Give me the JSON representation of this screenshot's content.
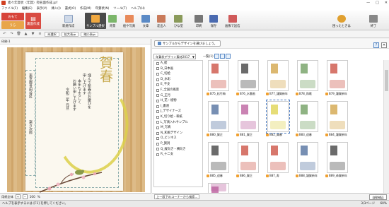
{
  "window": {
    "title": "素々年賀状（年賀）宛名面作成.jpf",
    "controls": [
      "—",
      "□",
      "✕"
    ]
  },
  "menu": [
    "ファイル(F)",
    "編集(E)",
    "表示(V)",
    "挿入(I)",
    "書式(O)",
    "作成(M)",
    "年賀状(N)",
    "ツール(T)",
    "ヘルプ(H)"
  ],
  "ribbon": {
    "side_tabs": {
      "front": "おもて",
      "back": "うら"
    },
    "vertical_tab": "新規作成",
    "buttons": [
      {
        "label": "新規作成"
      },
      {
        "label": "サンプル選択",
        "active": true
      },
      {
        "label": "背景"
      },
      {
        "label": "絵や写真"
      },
      {
        "label": "文章"
      },
      {
        "label": "差出人"
      },
      {
        "label": "ひな型"
      },
      {
        "label": "印刷"
      },
      {
        "label": "保存"
      },
      {
        "label": "画像で送信"
      }
    ],
    "right_buttons": [
      {
        "label": "困ったときは"
      },
      {
        "label": "終了"
      }
    ],
    "side_label": "裏面作成"
  },
  "toolbar2": {
    "chips": [
      "未選択",
      "拡大表示",
      "縮小表示"
    ]
  },
  "left_panel": {
    "header": "印刷-1",
    "postcard": {
      "kanji": "賀春",
      "message": [
        "謹んで新春のお慶びを",
        "申し上げます",
        "本年もよろしく",
        "お願い申し上げます",
        "令和二年 元旦"
      ],
      "name_lines": [
        "東京都世田谷区",
        "楽々次郎"
      ]
    },
    "zoom": {
      "label": "用紙全体",
      "value": "100",
      "unit": "%"
    }
  },
  "right_panel": {
    "button": "サンプルからデザインを選びましょう。",
    "category_select": "年賀状デザイン素材2017",
    "count": "一覧(1)",
    "categories": [
      {
        "label": "A_絵",
        "checked": false
      },
      {
        "label": "B_日本画",
        "checked": false
      },
      {
        "label": "C_切絵",
        "checked": false
      },
      {
        "label": "D_水彩",
        "checked": false
      },
      {
        "label": "E_干支",
        "checked": false
      },
      {
        "label": "F_全国の風景",
        "checked": false
      },
      {
        "label": "G_正月",
        "checked": false
      },
      {
        "label": "H_花・植物",
        "checked": false
      },
      {
        "label": "I_書道",
        "checked": false
      },
      {
        "label": "J_デザイナーズ",
        "checked": false
      },
      {
        "label": "K_切り絵・和紙",
        "checked": false
      },
      {
        "label": "L_写真入れサンプル",
        "checked": false
      },
      {
        "label": "M_写真",
        "checked": false
      },
      {
        "label": "N_和風デザイン",
        "checked": false
      },
      {
        "label": "O_ビジネス",
        "checked": false
      },
      {
        "label": "P_賀詞",
        "checked": false
      },
      {
        "label": "Q_縦向き・横向き",
        "checked": false
      },
      {
        "label": "R_十二支",
        "checked": false
      }
    ],
    "thumbnails": [
      {
        "label": "B75_松竹梅",
        "accent": "#c94a3b"
      },
      {
        "label": "B76_水墨画",
        "accent": "#3a3a3a"
      },
      {
        "label": "B77_謹賀新年",
        "accent": "#d0a040"
      },
      {
        "label": "B78_和歌",
        "accent": "#6a9a5a"
      },
      {
        "label": "B79_謹賀新年",
        "accent": "#c94a3b"
      },
      {
        "label": "B80_賀正",
        "accent": "#4a6a9a"
      },
      {
        "label": "B81_賀正",
        "accent": "#b85a9a"
      },
      {
        "label": "B82_賀春",
        "accent": "#ddd14a",
        "selected": true
      },
      {
        "label": "B83_迎春",
        "accent": "#6a9a5a"
      },
      {
        "label": "B84_謹賀新年",
        "accent": "#d0a040"
      },
      {
        "label": "B85_迎春",
        "accent": "#3a3a3a"
      },
      {
        "label": "B86_賀正",
        "accent": "#c94a3b"
      },
      {
        "label": "B87_寿",
        "accent": "#c94a3b"
      },
      {
        "label": "B88_謹賀新年",
        "accent": "#4a6a9a"
      },
      {
        "label": "B89_恭賀新年",
        "accent": "#3a3a3a"
      },
      {
        "label": "B90_賀春",
        "accent": "#b85a9a"
      }
    ],
    "footer": {
      "jump_label": "上一段下のコーナーから検索...",
      "auto": "自動補正"
    }
  },
  "status": {
    "hint": "ヘルプを表示するには [F1] を押してください。",
    "page": "3/3ページ",
    "ratio": "60%"
  },
  "colors": {
    "ribbon_red": "#d7443a",
    "accent_yellow": "#ddd14a",
    "woodgrain": "#d8b27a"
  }
}
